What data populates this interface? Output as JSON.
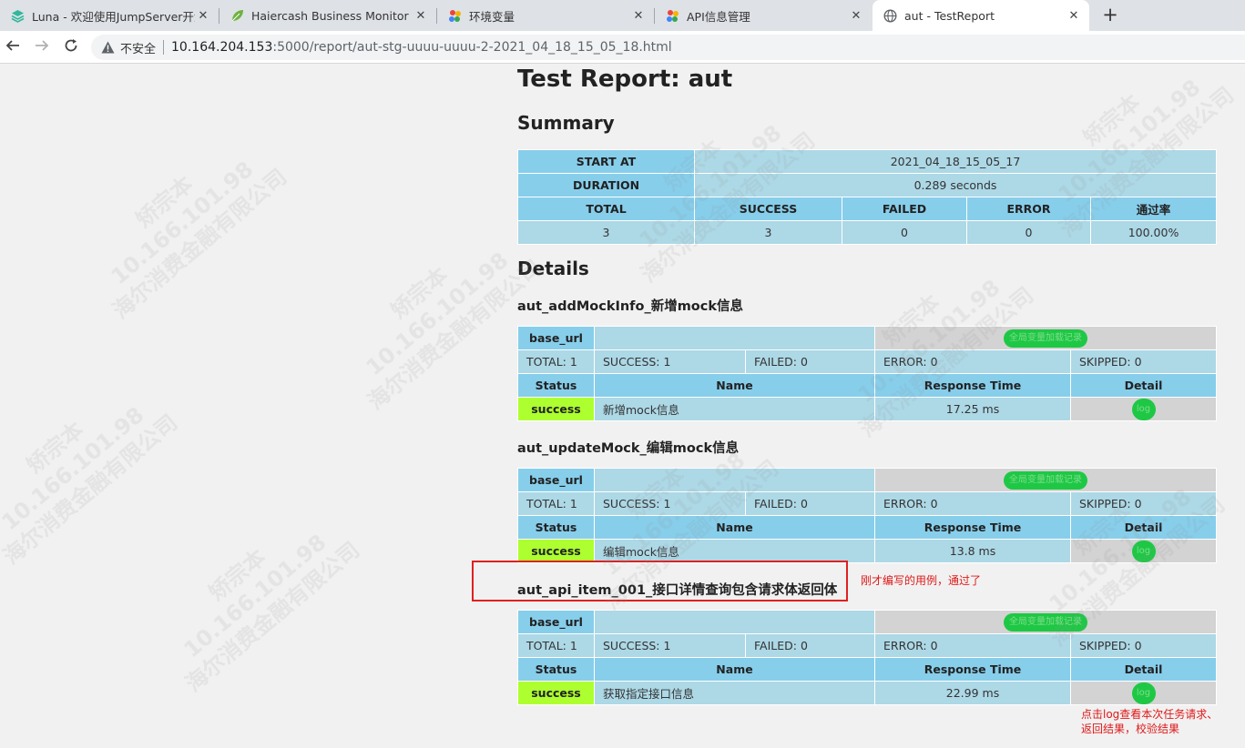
{
  "browser": {
    "tabs": [
      {
        "title": "Luna - 欢迎使用JumpServer开源",
        "icon": "stack-icon",
        "close": "✕"
      },
      {
        "title": "Haiercash Business Monitor",
        "icon": "leaf-icon",
        "close": "✕"
      },
      {
        "title": "环境变量",
        "icon": "pinwheel-icon",
        "close": "✕"
      },
      {
        "title": "API信息管理",
        "icon": "pinwheel-icon",
        "close": "✕"
      },
      {
        "title": "aut - TestReport",
        "icon": "globe-icon",
        "close": "✕"
      }
    ],
    "new_tab": "+",
    "address": {
      "security_label": "不安全",
      "host": "10.164.204.153",
      "path": ":5000/report/aut-stg-uuuu-uuuu-2-2021_04_18_15_05_18.html"
    }
  },
  "report": {
    "title": "Test Report: aut",
    "summary_heading": "Summary",
    "summary": {
      "start_label": "START AT",
      "start_value": "2021_04_18_15_05_17",
      "duration_label": "DURATION",
      "duration_value": "0.289 seconds",
      "headers": [
        "TOTAL",
        "SUCCESS",
        "FAILED",
        "ERROR",
        "通过率"
      ],
      "values": [
        "3",
        "3",
        "0",
        "0",
        "100.00%"
      ]
    },
    "details_heading": "Details",
    "cases": [
      {
        "title": "aut_addMockInfo_新增mock信息",
        "base_url_label": "base_url",
        "global_button": "全局变量加载记录",
        "stats": [
          "TOTAL: 1",
          "SUCCESS: 1",
          "FAILED: 0",
          "ERROR: 0",
          "SKIPPED: 0"
        ],
        "col_headers": [
          "Status",
          "Name",
          "Response Time",
          "Detail"
        ],
        "row": {
          "status": "success",
          "name": "新增mock信息",
          "response_time": "17.25 ms",
          "detail": "log"
        }
      },
      {
        "title": "aut_updateMock_编辑mock信息",
        "base_url_label": "base_url",
        "global_button": "全局变量加载记录",
        "stats": [
          "TOTAL: 1",
          "SUCCESS: 1",
          "FAILED: 0",
          "ERROR: 0",
          "SKIPPED: 0"
        ],
        "col_headers": [
          "Status",
          "Name",
          "Response Time",
          "Detail"
        ],
        "row": {
          "status": "success",
          "name": "编辑mock信息",
          "response_time": "13.8 ms",
          "detail": "log"
        }
      },
      {
        "title": "aut_api_item_001_接口详情查询包含请求体返回体",
        "base_url_label": "base_url",
        "global_button": "全局变量加载记录",
        "stats": [
          "TOTAL: 1",
          "SUCCESS: 1",
          "FAILED: 0",
          "ERROR: 0",
          "SKIPPED: 0"
        ],
        "col_headers": [
          "Status",
          "Name",
          "Response Time",
          "Detail"
        ],
        "row": {
          "status": "success",
          "name": "获取指定接口信息",
          "response_time": "22.99 ms",
          "detail": "log"
        }
      }
    ]
  },
  "annotations": {
    "case_note": "刚才编写的用例，通过了",
    "log_note_line1": "点击log查看本次任务请求、",
    "log_note_line2": "返回结果，校验结果"
  },
  "watermark": {
    "name": "矫宗本",
    "ip": "10.166.101.98",
    "company": "海尔消费金融有限公司"
  },
  "colors": {
    "header": "#87ceeb",
    "cell": "#add8e6",
    "success": "#adff2f",
    "grey": "#d3d3d3",
    "pill": "#1ec845",
    "annotation": "#e01818"
  }
}
